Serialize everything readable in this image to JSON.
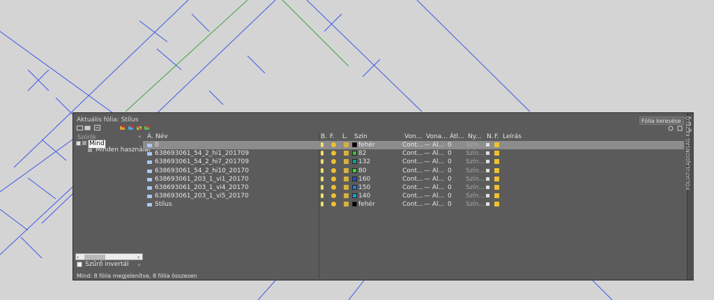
{
  "palette": {
    "title": "Aktuális fólia: Stílus",
    "search_placeholder": "Fólia keresése",
    "side_label": "FÓLIATULAJDONSÁG-KEZELŐ",
    "collapse_glyph": "«",
    "filters": {
      "header": "Szűrők",
      "root": "Mind",
      "child": "Minden használat",
      "invert_label": "Szűrő invertál"
    },
    "columns": [
      "Á.",
      "Név",
      "B.",
      "F.",
      "L.",
      "Szín",
      "Von...",
      "Vona...",
      "Átl...",
      "Ny...",
      "N.",
      "F.",
      "Leírás"
    ],
    "layers": [
      {
        "name": "0",
        "color_label": "fehér",
        "color_hex": "#000000",
        "linetype": "Cont...",
        "lineweight": "— Al...",
        "transparency": "0",
        "plot_style": "Szín...",
        "selected": true
      },
      {
        "name": "638693061_54_2_hi1_201709",
        "color_label": "82",
        "color_hex": "#3bbf3b",
        "linetype": "Cont...",
        "lineweight": "— Al...",
        "transparency": "0",
        "plot_style": "Szín...",
        "selected": false
      },
      {
        "name": "638693061_54_2_hi7_201709",
        "color_label": "132",
        "color_hex": "#0aa0a0",
        "linetype": "Cont...",
        "lineweight": "— Al...",
        "transparency": "0",
        "plot_style": "Szín...",
        "selected": false
      },
      {
        "name": "638693061_54_2_hi10_20170",
        "color_label": "80",
        "color_hex": "#39d82f",
        "linetype": "Cont...",
        "lineweight": "— Al...",
        "transparency": "0",
        "plot_style": "Szín...",
        "selected": false
      },
      {
        "name": "638693061_203_1_vi1_20170",
        "color_label": "160",
        "color_hex": "#1f4fd0",
        "linetype": "Cont...",
        "lineweight": "— Al...",
        "transparency": "0",
        "plot_style": "Szín...",
        "selected": false
      },
      {
        "name": "638693061_203_1_vi4_20170",
        "color_label": "150",
        "color_hex": "#1a7fe0",
        "linetype": "Cont...",
        "lineweight": "— Al...",
        "transparency": "0",
        "plot_style": "Szín...",
        "selected": false
      },
      {
        "name": "638693061_203_1_vi5_20170",
        "color_label": "140",
        "color_hex": "#0ea4d8",
        "linetype": "Cont...",
        "lineweight": "— Al...",
        "transparency": "0",
        "plot_style": "Szín...",
        "selected": false
      },
      {
        "name": "Stílus",
        "color_label": "fehér",
        "color_hex": "#000000",
        "linetype": "Cont...",
        "lineweight": "— Al...",
        "transparency": "0",
        "plot_style": "Szín...",
        "selected": false
      }
    ],
    "status": "Mind: 8 fólia megjelenítve, 8 fólia összesen"
  }
}
